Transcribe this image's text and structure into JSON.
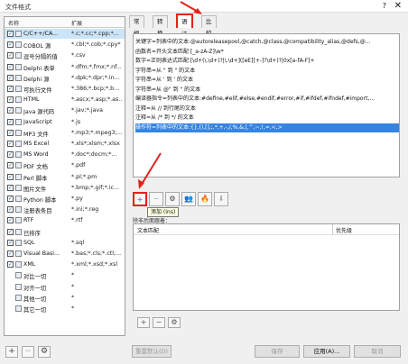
{
  "window": {
    "title": "文件格式",
    "help": "?",
    "close": "✕"
  },
  "left": {
    "headers": {
      "name": "名称",
      "ext": "扩展"
    },
    "rows": [
      {
        "checked": true,
        "name": "C/C++/CA...",
        "ext": "*.c;*.cc;*.cpp;*...",
        "selected": true
      },
      {
        "checked": true,
        "name": "COBOL 源",
        "ext": "*.cbl;*.cob;*.cpy*"
      },
      {
        "checked": true,
        "name": "逗号分隔的值",
        "ext": "*.csv"
      },
      {
        "checked": true,
        "name": "Delphi 表单",
        "ext": "*.dfm;*.fmx;*.nf..."
      },
      {
        "checked": true,
        "name": "Delphi 源",
        "ext": "*.dpk;*.dpr;*.in..."
      },
      {
        "checked": true,
        "name": "可执行文件",
        "ext": "*.386;*.bcp;*.b..."
      },
      {
        "checked": true,
        "name": "HTML",
        "ext": "*.ascx;*.asp;*.as..."
      },
      {
        "checked": true,
        "name": "Java 源代码",
        "ext": "*.jav;*.java"
      },
      {
        "checked": true,
        "name": "JavaScript",
        "ext": "*.js"
      },
      {
        "checked": true,
        "name": "MP3 文件",
        "ext": "*.mp3;*.mpeg3;..."
      },
      {
        "checked": true,
        "name": "MS Excel",
        "ext": "*.xls*;xlsm;*.xlsx"
      },
      {
        "checked": true,
        "name": "MS Word",
        "ext": "*.doc*;docm;*..."
      },
      {
        "checked": true,
        "name": "PDF 文档",
        "ext": "*.pdf"
      },
      {
        "checked": true,
        "name": "Perl 脚本",
        "ext": "*.pl;*.pm"
      },
      {
        "checked": true,
        "name": "图片文件",
        "ext": "*.bmp;*.gif;*.ic..."
      },
      {
        "checked": true,
        "name": "Python 脚本",
        "ext": "*.py"
      },
      {
        "checked": true,
        "name": "注册表条目",
        "ext": "*.ini;*.reg"
      },
      {
        "checked": true,
        "name": "RTF",
        "ext": "*.rtf"
      },
      {
        "checked": true,
        "name": "已排序",
        "ext": ""
      },
      {
        "checked": true,
        "name": "SQL",
        "ext": "*.sql"
      },
      {
        "checked": true,
        "name": "Visual Basi...",
        "ext": "*.bas;*.cls;*.ctl;..."
      },
      {
        "checked": true,
        "name": "XML",
        "ext": "*.xml;*.xsd;*.xsl"
      },
      {
        "checked": false,
        "name": "对比一切",
        "ext": "*"
      },
      {
        "checked": false,
        "name": "对齐一切",
        "ext": "*"
      },
      {
        "checked": false,
        "name": "其他一切",
        "ext": "*"
      },
      {
        "checked": false,
        "name": "其它一切",
        "ext": "*"
      }
    ],
    "buttons": [
      "+",
      "−",
      "⚙"
    ]
  },
  "tabs": [
    "常规",
    "转换",
    "语法",
    "比较"
  ],
  "activeTab": 2,
  "regex_lines": [
    "关键字=列表中的文本:@autoreleasepool,@catch,@class,@compatibility_alias,@defs,@...",
    "函数名=开头文本匹配 [_a-zA-Z]\\w*",
    "数字=正则表达式匹配 [\\d+(\\.\\d+)?|\\.\\d+]([eE][+-]?\\d+)?|0x[a-fA-F]+",
    "字符串=从 \" 到 \" 的文本",
    "字符串=从 ' 到 ' 的文本",
    "字符串=从 @\" 到 \" 的文本",
    "编译器指令=列表中的文本:#define,#elif,#else,#endif,#error,#if,#ifdef,#ifndef,#import,...",
    "注释=从 // 到行尾的文本",
    "注释=从 /* 到 */ 的文本",
    "操作符=列表中的文本:{},(),[],;,*,+,-,/,%,&,|,^,~,!,=,<,>"
  ],
  "selectedRegexIndex": 9,
  "tools": [
    "+",
    "−",
    "⚙",
    "👥",
    "🔥",
    "⬇"
  ],
  "tooltip": "添加 (Ins)",
  "section_label": "除非后面跟着：",
  "table_headers": {
    "text": "文本匹配",
    "priority": "优先级"
  },
  "mini_buttons": [
    "+",
    "−",
    "⚙"
  ],
  "bottom": {
    "reset": "重置默认(D)",
    "save": "保存",
    "use": "应用(A)...",
    "cancel": "取消"
  }
}
